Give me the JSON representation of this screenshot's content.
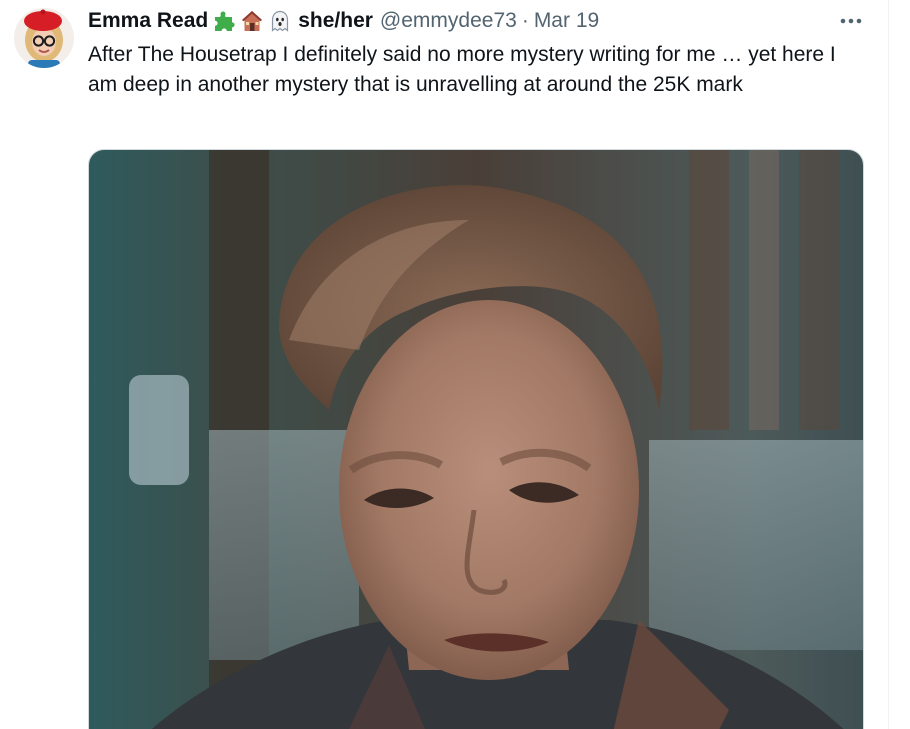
{
  "tweet": {
    "author": {
      "display_name": "Emma Read",
      "emoji_icons": [
        "puzzle-piece-icon",
        "house-icon",
        "ghost-icon"
      ],
      "pronouns": "she/her",
      "handle": "@emmydee73"
    },
    "separator": "·",
    "date": "Mar 19",
    "text": "After The Housetrap I definitely said no more mystery writing for me … yet here I am deep in another mystery that is unravelling at around the 25K mark",
    "media": {
      "type": "image",
      "icon": "video-still-image"
    },
    "more_icon": "more-options-icon"
  },
  "colors": {
    "text_primary": "#0f1419",
    "text_secondary": "#536471",
    "border": "#cfd9de",
    "puzzle_green": "#2e9a3e"
  }
}
